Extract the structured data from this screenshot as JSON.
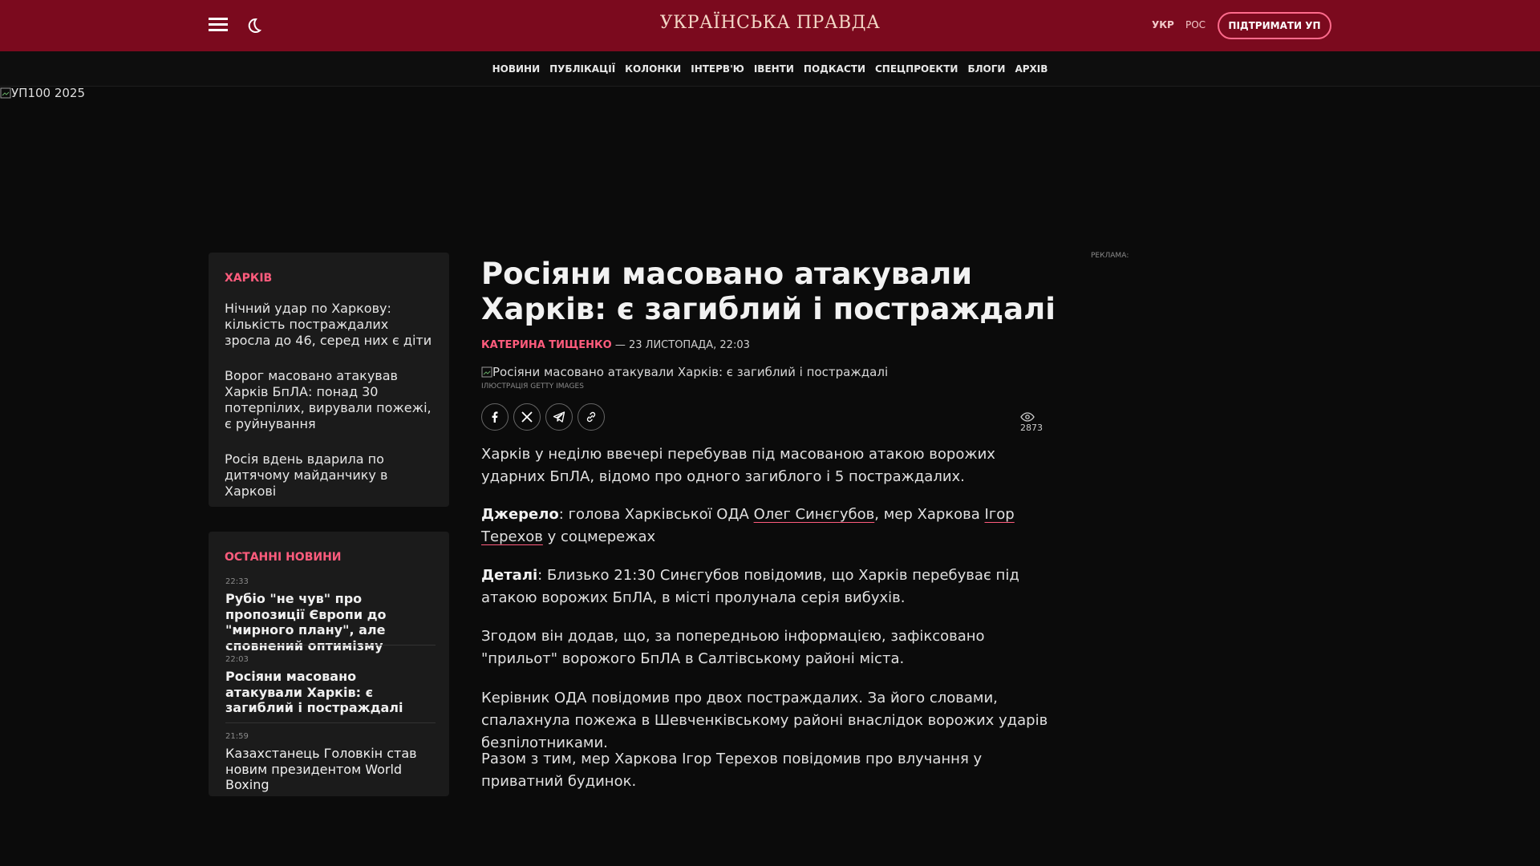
{
  "header": {
    "logo": "УКРАЇНСЬКА ПРАВДА",
    "lang_ukr": "УКР",
    "lang_ros": "РОС",
    "support_label": "ПІДТРИМАТИ УП"
  },
  "nav": [
    "НОВИНИ",
    "ПУБЛІКАЦІЇ",
    "КОЛОНКИ",
    "ІНТЕРВ'Ю",
    "ІВЕНТИ",
    "ПОДКАСТИ",
    "СПЕЦПРОЕКТИ",
    "БЛОГИ",
    "АРХІВ"
  ],
  "banner_alt": "УП100 2025",
  "city_block": {
    "title": "ХАРКІВ",
    "items": [
      "Нічний удар по Харкову: кількість постраждалих зросла до 46, серед них є діти",
      "Ворог масовано атакував Харків БпЛА: понад 30 потерпілих, вирували пожежі, є руйнування",
      "Росія вдень вдарила по дитячому майданчику в Харкові"
    ]
  },
  "latest": {
    "title": "ОСТАННІ НОВИНИ",
    "items": [
      {
        "time": "22:33",
        "text": "Рубіо \"не чув\" про пропозиції Європи до \"мирного плану\", але сповнений оптимізму",
        "bold": true
      },
      {
        "time": "22:03",
        "text": "Росіяни масовано атакували Харків: є загиблий і постраждалі",
        "bold": true
      },
      {
        "time": "21:59",
        "text": "Казахстанець Головкін став новим президентом World Boxing",
        "bold": false
      }
    ]
  },
  "article": {
    "headline": "Росіяни масовано атакували Харків: є загиблий і постраждалі",
    "author": "КАТЕРИНА ТИЩЕНКО",
    "date": " — 23 ЛИСТОПАДА, 22:03",
    "photo_alt": "Росіяни масовано атакували Харків: є загиблий і постраждалі",
    "photo_credit": "ІЛЮСТРАЦІЯ GETTY IMAGES",
    "views": "2873",
    "p1": "Харків у неділю ввечері перебував під масованою атакою ворожих ударних БпЛА, відомо про одного загиблого і 5 постраждалих.",
    "p2_label": "Джерело",
    "p2_a": ": голова Харківської ОДА ",
    "p2_link1": "Олег Синєгубов",
    "p2_b": ", мер Харкова ",
    "p2_link2": "Ігор Терехов",
    "p2_c": " у соцмережах",
    "p3_label": "Деталі",
    "p3_text": ": Близько 21:30 Синєгубов повідомив, що Харків перебуває під атакою ворожих БпЛА, в місті пролунала серія вибухів.",
    "p4": "Згодом він додав, що, за попередньою інформацією, зафіксовано \"прильот\" ворожого БпЛА в Салтівському районі міста.",
    "p5": "Керівник ОДА повідомив про двох постраждалих. За його словами, спалахнула пожежа в Шевченківському районі внаслідок ворожих ударів безпілотниками.",
    "p6": "Разом з тим, мер Харкова Ігор Терехов повідомив про влучання у приватний будинок."
  },
  "ad_label": "РЕКЛАМА:",
  "colors": {
    "header": "#7b0a1e",
    "accent": "#ff5c7d",
    "background": "#0b0b0b",
    "card": "#1b1b1b"
  }
}
